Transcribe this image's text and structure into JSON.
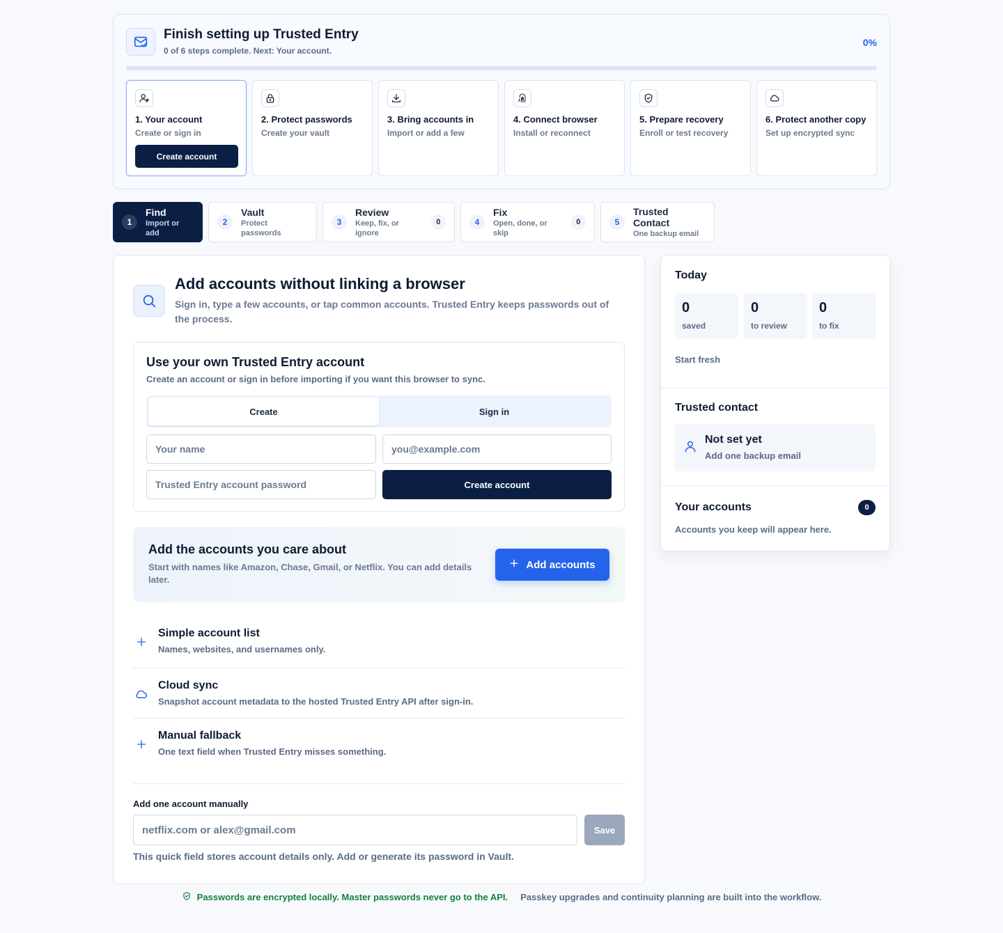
{
  "setup": {
    "title": "Finish setting up Trusted Entry",
    "subtitle": "0 of 6 steps complete. Next: Your account.",
    "percent_label": "0%",
    "progress": 0,
    "steps": [
      {
        "title": "1. Your account",
        "sub": "Create or sign in",
        "icon": "user-plus-icon",
        "button": "Create account"
      },
      {
        "title": "2. Protect passwords",
        "sub": "Create your vault",
        "icon": "lock-icon"
      },
      {
        "title": "3. Bring accounts in",
        "sub": "Import or add a few",
        "icon": "download-icon"
      },
      {
        "title": "4. Connect browser",
        "sub": "Install or reconnect",
        "icon": "fingerprint-icon"
      },
      {
        "title": "5. Prepare recovery",
        "sub": "Enroll or test recovery",
        "icon": "shield-check-icon"
      },
      {
        "title": "6. Protect another copy",
        "sub": "Set up encrypted sync",
        "icon": "cloud-icon"
      }
    ]
  },
  "tabs": [
    {
      "num": "1",
      "title": "Find",
      "sub": "Import or add",
      "active": true
    },
    {
      "num": "2",
      "title": "Vault",
      "sub": "Protect passwords"
    },
    {
      "num": "3",
      "title": "Review",
      "sub": "Keep, fix, or ignore",
      "count": "0"
    },
    {
      "num": "4",
      "title": "Fix",
      "sub": "Open, done, or skip",
      "count": "0"
    },
    {
      "num": "5",
      "title": "Trusted Contact",
      "sub": "One backup email"
    }
  ],
  "main": {
    "title": "Add accounts without linking a browser",
    "subtitle": "Sign in, type a few accounts, or tap common accounts. Trusted Entry keeps passwords out of the process.",
    "account": {
      "title": "Use your own Trusted Entry account",
      "subtitle": "Create an account or sign in before importing if you want this browser to sync.",
      "mode_create": "Create",
      "mode_signin": "Sign in",
      "name_placeholder": "Your name",
      "email_placeholder": "you@example.com",
      "password_placeholder": "Trusted Entry account password",
      "create_button": "Create account"
    },
    "care": {
      "title": "Add the accounts you care about",
      "subtitle": "Start with names like Amazon, Chase, Gmail, or Netflix. You can add details later.",
      "button": "Add accounts"
    },
    "options": [
      {
        "title": "Simple account list",
        "sub": "Names, websites, and usernames only.",
        "icon": "plus-icon"
      },
      {
        "title": "Cloud sync",
        "sub": "Snapshot account metadata to the hosted Trusted Entry API after sign-in.",
        "icon": "cloud-icon"
      },
      {
        "title": "Manual fallback",
        "sub": "One text field when Trusted Entry misses something.",
        "icon": "plus-icon"
      }
    ],
    "manual": {
      "label": "Add one account manually",
      "placeholder": "netflix.com or alex@gmail.com",
      "save": "Save",
      "note": "This quick field stores account details only. Add or generate its password in Vault."
    }
  },
  "side": {
    "today": {
      "title": "Today",
      "stats": [
        {
          "num": "0",
          "label": "saved"
        },
        {
          "num": "0",
          "label": "to review"
        },
        {
          "num": "0",
          "label": "to fix"
        }
      ],
      "link": "Start fresh"
    },
    "contact": {
      "title": "Trusted contact",
      "status": "Not set yet",
      "hint": "Add one backup email"
    },
    "accounts": {
      "title": "Your accounts",
      "count": "0",
      "empty": "Accounts you keep will appear here."
    }
  },
  "footer": {
    "secure": "Passwords are encrypted locally. Master passwords never go to the API.",
    "note": "Passkey upgrades and continuity planning are built into the workflow."
  },
  "colors": {
    "accent": "#2563eb",
    "navy": "#0b1f45",
    "success": "#15803d"
  }
}
